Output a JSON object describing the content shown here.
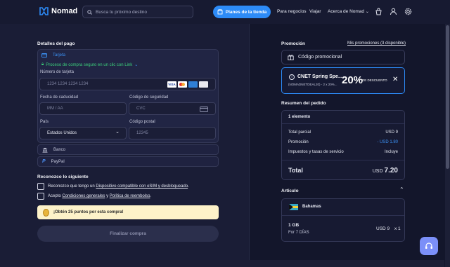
{
  "header": {
    "logo_text": "Nomad",
    "search_placeholder": "Busca tu próximo destino",
    "cta_label": "Planes de la tienda",
    "nav": [
      "Para negocios",
      "Viajar",
      "Acerca de Nomad"
    ],
    "icons": [
      "basket-icon",
      "user-icon",
      "gear-icon"
    ]
  },
  "payment": {
    "section_title": "Detalles del pago",
    "card_tab": "Tarjeta",
    "link_text": "Proceso de compra seguro en un clic con Link",
    "card_number_label": "Número de tarjeta",
    "card_number_placeholder": "1234 1234 1234 1234",
    "card_brands": [
      "VISA",
      "MC",
      "AMEX",
      "UP"
    ],
    "expiry_label": "Fecha de caducidad",
    "expiry_placeholder": "MM / AA",
    "cvc_label": "Código de seguridad",
    "cvc_placeholder": "CVC",
    "country_label": "País",
    "country_value": "Estados Unidos",
    "postal_label": "Código postal",
    "postal_placeholder": "12345",
    "bank_label": "Banco",
    "paypal_label": "PayPal"
  },
  "acknowledge": {
    "title": "Reconozco lo siguiente",
    "item1_prefix": "Reconozco que tengo un ",
    "item1_link": "Dispositivo compatible con eSIM y desbloqueado",
    "item1_suffix": ".",
    "item2_prefix": "Acepto ",
    "item2_link1": "Condiciones generales",
    "item2_mid": " y ",
    "item2_link2": "Política de reembolso",
    "item2_suffix": "."
  },
  "points_banner": "¡Obtén 25 puntos por esta compra!",
  "finish_button": "Finalizar compra",
  "promo": {
    "title": "Promoción",
    "my_promos_link": "Mis promociones (3 disponible)",
    "code_label": "Código promocional",
    "coupon_title": "CNET Spring Spe...",
    "coupon_sub": "(NOMADNETDEAL20) - 2 x 20%...",
    "coupon_percent": "20%",
    "coupon_desc": "DE DESCUENTO"
  },
  "order": {
    "title": "Resumen del pedido",
    "items_count": "1 elemento",
    "rows": [
      {
        "label": "Total parcial",
        "value": "USD 9"
      },
      {
        "label": "Promoción",
        "value": "- USD 1.80"
      },
      {
        "label": "Impuestos y tasas de servicio",
        "value": "Incluye"
      }
    ],
    "total_label": "Total",
    "total_currency": "USD",
    "total_value": "7.20"
  },
  "article": {
    "title": "Artículo",
    "country": "Bahamas",
    "plan_data": "1 GB",
    "plan_days": "For 7 DÍAS",
    "price": "USD 9",
    "qty": "x 1"
  },
  "colors": {
    "accent": "#2d8bf7",
    "background": "#12152a",
    "panel": "#1a1d36",
    "success": "#3ccf7b",
    "banner": "#fdf2c9"
  }
}
